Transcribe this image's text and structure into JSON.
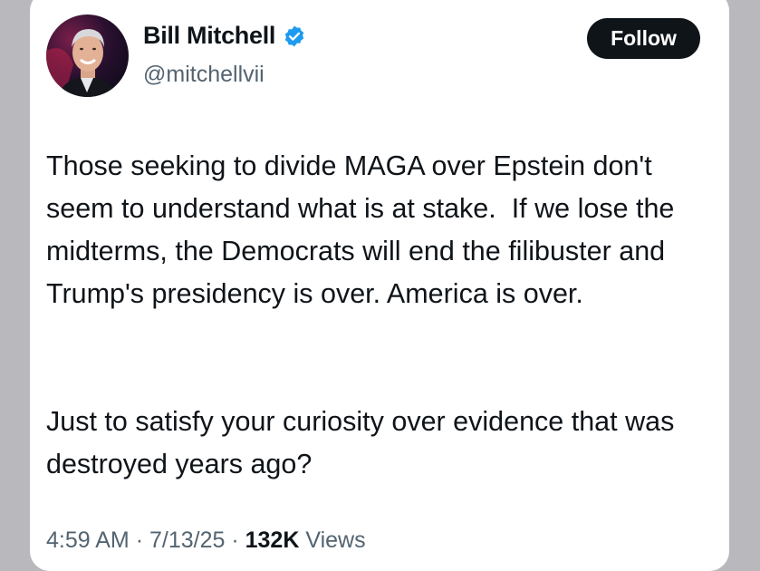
{
  "author": {
    "display_name": "Bill Mitchell",
    "handle": "@mitchellvii",
    "verified": true,
    "verified_color": "#1d9bf0",
    "avatar_icon": "avatar"
  },
  "actions": {
    "follow_label": "Follow"
  },
  "tweet": {
    "paragraph_1": "Those seeking to divide MAGA over Epstein don't seem to understand what is at stake.  If we lose the midterms, the Democrats will end the filibuster and Trump's presidency is over. America is over.",
    "paragraph_2": "Just to satisfy your curiosity over evidence that was destroyed years ago?"
  },
  "meta": {
    "time": "4:59 AM",
    "separator": "·",
    "date": "7/13/25",
    "views_count": "132K",
    "views_label": "Views"
  }
}
